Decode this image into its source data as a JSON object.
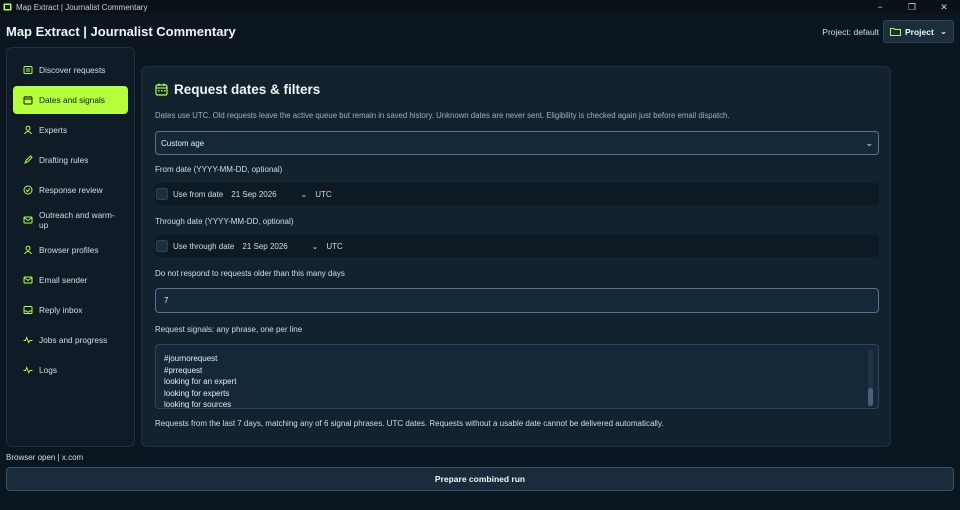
{
  "window": {
    "title": "Map Extract | Journalist Commentary",
    "minimize": "−",
    "restore": "❐",
    "close": "✕"
  },
  "header": {
    "title": "Map Extract | Journalist Commentary",
    "project_label": "Project: default",
    "project_button": "Project"
  },
  "sidebar": {
    "items": [
      {
        "label": "Discover requests",
        "icon": "list-icon",
        "active": false
      },
      {
        "label": "Dates and signals",
        "icon": "calendar-icon",
        "active": true
      },
      {
        "label": "Experts",
        "icon": "person-icon",
        "active": false
      },
      {
        "label": "Drafting rules",
        "icon": "pencil-icon",
        "active": false
      },
      {
        "label": "Response review",
        "icon": "check-circle-icon",
        "active": false
      },
      {
        "label": "Outreach and warm-up",
        "icon": "envelope-icon",
        "active": false
      },
      {
        "label": "Browser profiles",
        "icon": "person-icon",
        "active": false
      },
      {
        "label": "Email sender",
        "icon": "envelope-icon",
        "active": false
      },
      {
        "label": "Reply inbox",
        "icon": "inbox-icon",
        "active": false
      },
      {
        "label": "Jobs and progress",
        "icon": "pulse-icon",
        "active": false
      },
      {
        "label": "Logs",
        "icon": "pulse-icon",
        "active": false
      }
    ]
  },
  "panel": {
    "title": "Request dates & filters",
    "hint": "Dates use UTC. Old requests leave the active queue but remain in saved history. Unknown dates are never sent. Eligibility is checked again just before email dispatch.",
    "age_select": "Custom age",
    "from": {
      "label": "From date (YYYY-MM-DD, optional)",
      "checkbox_label": "Use from date",
      "date": "21 Sep 2026",
      "tz": "UTC",
      "checked": false
    },
    "through": {
      "label": "Through date (YYYY-MM-DD, optional)",
      "checkbox_label": "Use through date",
      "date": "21 Sep 2026",
      "tz": "UTC",
      "checked": false
    },
    "max_age": {
      "label": "Do not respond to requests older than this many days",
      "value": "7"
    },
    "signals": {
      "label": "Request signals: any phrase, one per line",
      "lines": [
        "#journorequest",
        "#prrequest",
        "looking for an expert",
        "looking for experts",
        "looking for sources"
      ]
    },
    "summary": "Requests from the last 7 days, matching any of 6 signal phrases. UTC dates. Requests without a usable date cannot be delivered automatically."
  },
  "status": "Browser open | x.com",
  "run_button": "Prepare combined run",
  "colors": {
    "accent": "#b6ff3c",
    "background": "#0b1620",
    "panel": "#13222f"
  }
}
